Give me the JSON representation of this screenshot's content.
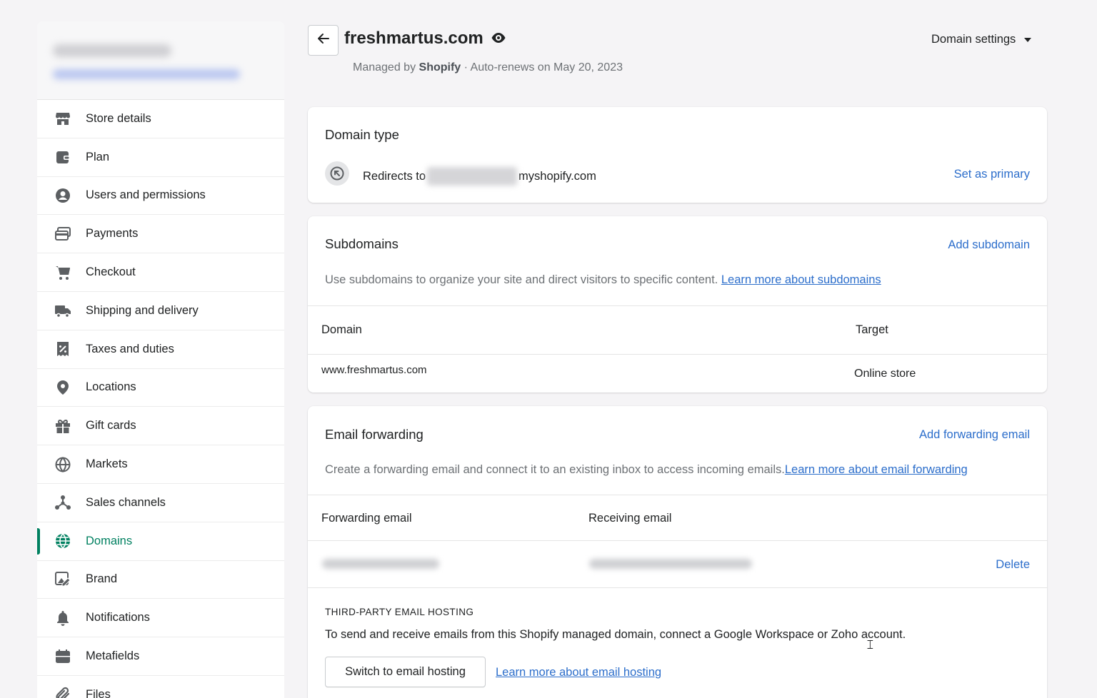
{
  "sidebar": {
    "items": [
      {
        "label": "Store details",
        "icon": "store-icon"
      },
      {
        "label": "Plan",
        "icon": "wallet-icon"
      },
      {
        "label": "Users and permissions",
        "icon": "user-circle-icon"
      },
      {
        "label": "Payments",
        "icon": "credit-card-icon"
      },
      {
        "label": "Checkout",
        "icon": "cart-icon"
      },
      {
        "label": "Shipping and delivery",
        "icon": "truck-icon"
      },
      {
        "label": "Taxes and duties",
        "icon": "receipt-percent-icon"
      },
      {
        "label": "Locations",
        "icon": "location-pin-icon"
      },
      {
        "label": "Gift cards",
        "icon": "gift-icon"
      },
      {
        "label": "Markets",
        "icon": "globe-markets-icon"
      },
      {
        "label": "Sales channels",
        "icon": "network-icon"
      },
      {
        "label": "Domains",
        "icon": "globe-icon",
        "active": true
      },
      {
        "label": "Brand",
        "icon": "brand-icon"
      },
      {
        "label": "Notifications",
        "icon": "bell-icon"
      },
      {
        "label": "Metafields",
        "icon": "metafields-icon"
      },
      {
        "label": "Files",
        "icon": "paperclip-icon"
      }
    ]
  },
  "header": {
    "title": "freshmartus.com",
    "subtitle_prefix": "Managed by",
    "subtitle_manager": "Shopify",
    "subtitle_suffix": "· Auto-renews on May 20, 2023",
    "domain_settings_label": "Domain settings"
  },
  "domain_type": {
    "title": "Domain type",
    "redirect_prefix": "Redirects to",
    "redirect_suffix": "myshopify.com",
    "set_primary_label": "Set as primary"
  },
  "subdomains": {
    "title": "Subdomains",
    "add_label": "Add subdomain",
    "description": "Use subdomains to organize your site and direct visitors to specific content.",
    "learn_more": "Learn more about subdomains",
    "columns": [
      "Domain",
      "Target"
    ],
    "rows": [
      {
        "domain": "www.freshmartus.com",
        "target": "Online store"
      }
    ]
  },
  "email_forwarding": {
    "title": "Email forwarding",
    "add_label": "Add forwarding email",
    "description": "Create a forwarding email and connect it to an existing inbox to access incoming emails.",
    "learn_more": "Learn more about email forwarding",
    "columns": [
      "Forwarding email",
      "Receiving email"
    ],
    "delete_label": "Delete",
    "hosting_caption": "THIRD-PARTY EMAIL HOSTING",
    "hosting_description": "To send and receive emails from this Shopify managed domain, connect a Google Workspace or Zoho account.",
    "hosting_button": "Switch to email hosting",
    "hosting_learn_more": "Learn more about email hosting"
  },
  "colors": {
    "accent": "#008060",
    "link": "#2c6ecb",
    "background": "#f5f4f6"
  }
}
